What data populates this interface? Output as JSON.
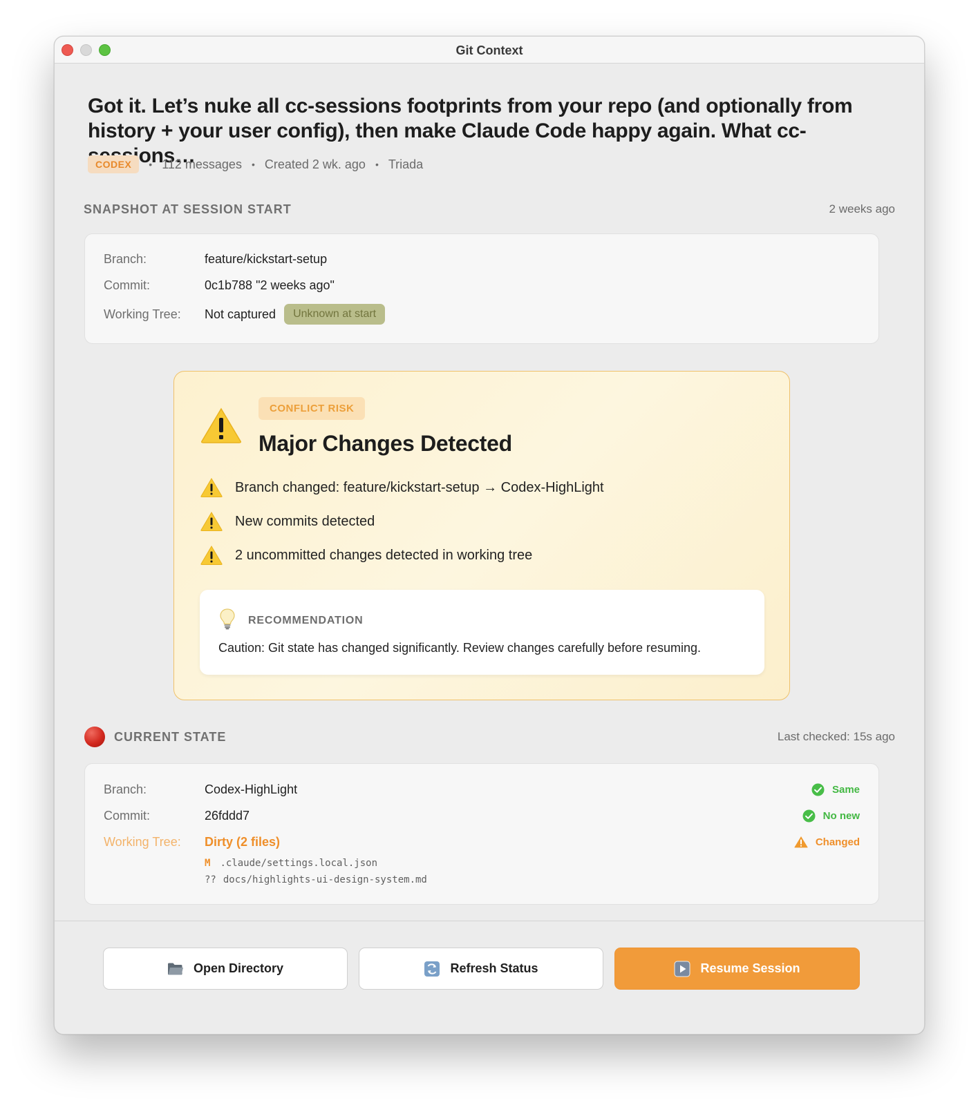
{
  "window": {
    "title": "Git Context"
  },
  "session": {
    "headline": "Got it. Let’s nuke all cc-sessions footprints from your repo (and optionally from history + your user config), then make Claude Code happy again. What cc-sessions…",
    "source_badge": "CODEX",
    "messages": "112 messages",
    "created": "Created 2 wk. ago",
    "project": "Triada"
  },
  "snapshot": {
    "label": "SNAPSHOT AT SESSION START",
    "age": "2 weeks ago",
    "branch_key": "Branch:",
    "branch_value": "feature/kickstart-setup",
    "commit_key": "Commit:",
    "commit_value": "0c1b788 \"2 weeks ago\"",
    "tree_key": "Working Tree:",
    "tree_value": "Not captured",
    "tree_badge": "Unknown at start"
  },
  "conflict": {
    "badge": "CONFLICT RISK",
    "title": "Major Changes Detected",
    "items": [
      "Branch changed: feature/kickstart-setup → Codex-HighLight",
      "New commits detected",
      "2 uncommitted changes detected in working tree"
    ],
    "recommendation_label": "RECOMMENDATION",
    "recommendation_text": "Caution: Git state has changed significantly. Review changes carefully before resuming."
  },
  "current": {
    "label": "CURRENT STATE",
    "last_checked": "Last checked: 15s ago",
    "branch_key": "Branch:",
    "branch_value": "Codex-HighLight",
    "branch_status": "Same",
    "commit_key": "Commit:",
    "commit_value": "26fddd7",
    "commit_status": "No new",
    "tree_key": "Working Tree:",
    "tree_value": "Dirty (2 files)",
    "tree_status": "Changed",
    "files": [
      {
        "status": "M",
        "path": ".claude/settings.local.json"
      },
      {
        "status": "??",
        "path": "docs/highlights-ui-design-system.md"
      }
    ]
  },
  "actions": {
    "open_directory": "Open Directory",
    "refresh_status": "Refresh Status",
    "resume_session": "Resume Session"
  },
  "colors": {
    "accent": "#f19b3a",
    "warning": "#ef8f2a",
    "ok": "#43b843",
    "danger": "#d2291f"
  }
}
